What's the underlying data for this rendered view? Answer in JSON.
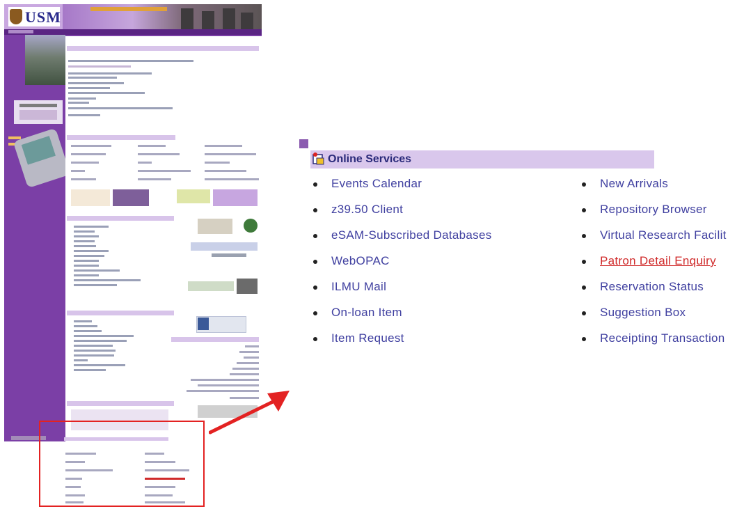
{
  "thumbnail": {
    "logo_text": "USM"
  },
  "online_services": {
    "title": "Online Services",
    "left_column": [
      {
        "label": "Events Calendar"
      },
      {
        "label": "z39.50 Client"
      },
      {
        "label": "eSAM-Subscribed Databases"
      },
      {
        "label": "WebOPAC"
      },
      {
        "label": "ILMU Mail"
      },
      {
        "label": "On-loan Item"
      },
      {
        "label": "Item Request"
      }
    ],
    "right_column": [
      {
        "label": "New Arrivals"
      },
      {
        "label": "Repository Browser"
      },
      {
        "label": "Virtual Research Facilit"
      },
      {
        "label": "Patron Detail Enquiry",
        "active": true
      },
      {
        "label": "Reservation Status"
      },
      {
        "label": "Suggestion Box"
      },
      {
        "label": "Receipting Transaction"
      }
    ]
  },
  "colors": {
    "highlight_box": "#e32222",
    "arrow": "#e32222",
    "link": "#4040a0",
    "active_link": "#d02b2b",
    "header_band": "#d9c7ec",
    "page_purple": "#7b3fa6"
  }
}
